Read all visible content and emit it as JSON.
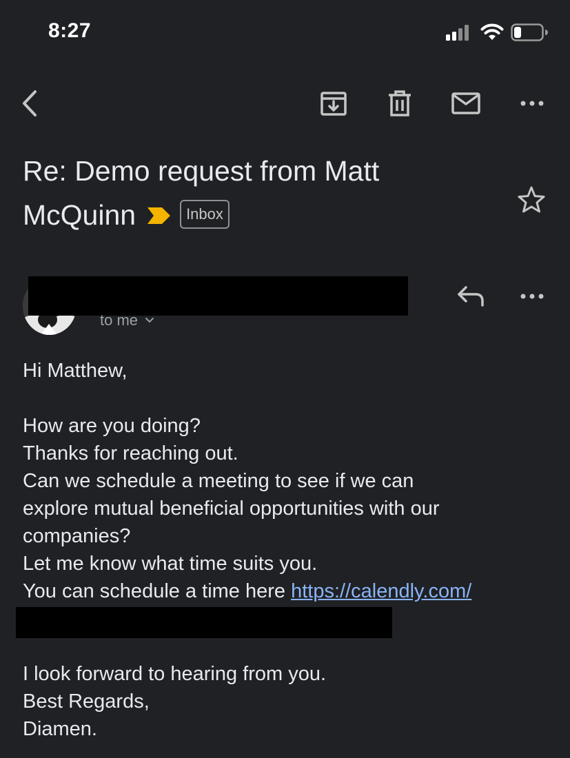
{
  "status_bar": {
    "time": "8:27"
  },
  "toolbar": {
    "back_icon": "chevron-left-icon",
    "archive_icon": "archive-icon",
    "delete_icon": "trash-icon",
    "mark_unread_icon": "mail-icon",
    "more_icon": "more-horizontal-icon"
  },
  "email": {
    "subject_line1": "Re: Demo request from Matt",
    "subject_line2": "McQuinn",
    "label": "Inbox",
    "importance_color": "#f4b400",
    "recipient": "to me",
    "body": {
      "greeting": "Hi Matthew,",
      "line1": "How are you doing?",
      "line2": "Thanks for reaching out.",
      "line3": "Can we schedule a meeting to see if we can",
      "line4": "explore mutual beneficial opportunities with our",
      "line5": "companies?",
      "line6": "Let me know what time suits you.",
      "line7_prefix": "You can schedule a time here ",
      "link_text": "https://calendly.com/",
      "closing1": "I look forward to hearing from you.",
      "closing2": "Best Regards,",
      "signature": "Diamen."
    }
  },
  "colors": {
    "background": "#202124",
    "text": "#e8eaed",
    "link": "#8ab4f8",
    "secondary_text": "#9aa0a6"
  }
}
